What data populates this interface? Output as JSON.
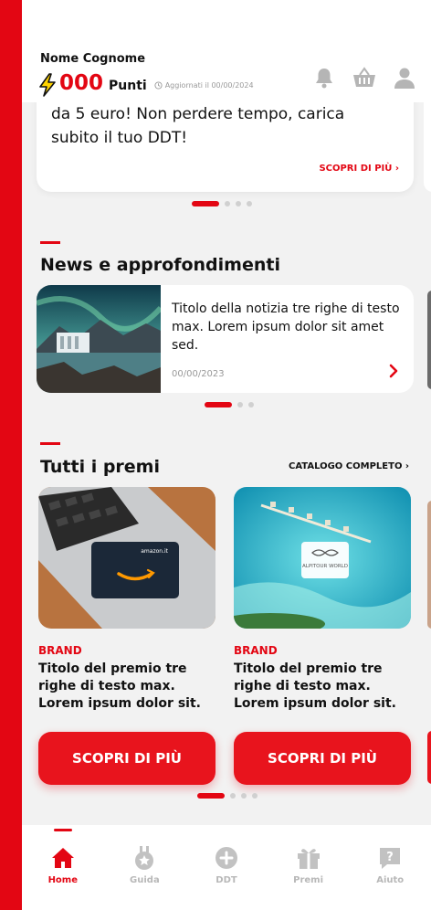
{
  "header": {
    "user_name": "Nome Cognome",
    "points_value": "000",
    "points_label": "Punti",
    "updated_text": "Aggiornati il 00/00/2024"
  },
  "promo": {
    "text": "da 5 euro! Non perdere tempo, carica subito il tuo DDT!",
    "cta": "SCOPRI DI PIÙ  ›"
  },
  "news": {
    "section_title": "News e approfondimenti",
    "item": {
      "title": "Titolo della notizia tre righe di testo max. Lorem ipsum dolor sit amet sed.",
      "date": "00/00/2023"
    }
  },
  "prizes": {
    "section_title": "Tutti i premi",
    "catalog_link": "CATALOGO COMPLETO  ›",
    "items": [
      {
        "brand": "BRAND",
        "title": "Titolo del premio tre righe di testo max. Lorem ipsum dolor sit.",
        "button": "SCOPRI DI PIÙ",
        "image_label": "amazon.it"
      },
      {
        "brand": "BRAND",
        "title": "Titolo del premio tre righe di testo max. Lorem ipsum dolor sit.",
        "button": "SCOPRI DI PIÙ",
        "image_label": "ALPITOUR WORLD"
      }
    ]
  },
  "nav": [
    {
      "label": "Home",
      "icon": "home-icon",
      "active": true
    },
    {
      "label": "Guida",
      "icon": "medal-icon",
      "active": false
    },
    {
      "label": "DDT",
      "icon": "plus-circle-icon",
      "active": false
    },
    {
      "label": "Premi",
      "icon": "gift-icon",
      "active": false
    },
    {
      "label": "Aiuto",
      "icon": "help-icon",
      "active": false
    }
  ],
  "colors": {
    "brand_red": "#e30613",
    "background": "#f2f2f2"
  }
}
